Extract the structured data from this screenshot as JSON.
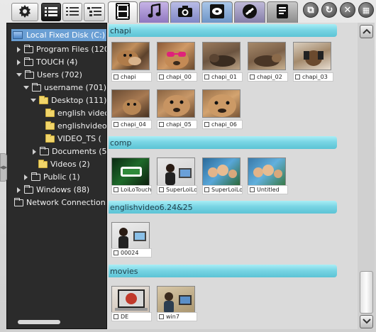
{
  "toolbar": {
    "settings_icon": "gear-icon",
    "view_buttons": [
      "details-view-icon",
      "list-view-icon",
      "tree-view-icon"
    ],
    "tabs": [
      {
        "name": "video",
        "icon": "film-icon",
        "active": true
      },
      {
        "name": "music",
        "icon": "music-note-icon",
        "active": false
      },
      {
        "name": "photo",
        "icon": "camera-icon",
        "active": false
      },
      {
        "name": "dvd",
        "icon": "dvd-icon",
        "active": false
      },
      {
        "name": "disc",
        "icon": "disc-icon",
        "active": false
      },
      {
        "name": "document",
        "icon": "document-icon",
        "active": false
      }
    ],
    "window_buttons": [
      "external-icon",
      "refresh-icon",
      "close-icon",
      "grid-menu-icon"
    ]
  },
  "sidebar": {
    "items": [
      {
        "label": "Local Fixed Disk (C:)",
        "selected": true
      },
      {
        "label": "Program Files  (120"
      },
      {
        "label": "TOUCH  (4)"
      },
      {
        "label": "Users  (702)"
      },
      {
        "label": "username  (701)"
      },
      {
        "label": "Desktop  (111)"
      },
      {
        "label": "english video"
      },
      {
        "label": "englishvideo"
      },
      {
        "label": "VIDEO_TS  ("
      },
      {
        "label": "Documents  (5"
      },
      {
        "label": "Videos  (2)"
      },
      {
        "label": "Public  (1)"
      },
      {
        "label": "Windows  (88)"
      },
      {
        "label": "Network Connection ("
      }
    ]
  },
  "groups": [
    {
      "name": "chapi",
      "items": [
        "chapi",
        "chapi_00",
        "chapi_01",
        "chapi_02",
        "chapi_03",
        "chapi_04",
        "chapi_05",
        "chapi_06"
      ]
    },
    {
      "name": "comp",
      "items": [
        "LoiLoTouch",
        "SuperLoiLoS",
        "SuperLoiLoS",
        "Untitled"
      ]
    },
    {
      "name": "englishvideo6.24&25",
      "items": [
        "00024"
      ]
    },
    {
      "name": "movies",
      "items": [
        "DE",
        "win7"
      ]
    }
  ],
  "colors": {
    "group_header": "#79d5e4",
    "sidebar_bg": "#2b2b2b",
    "selection": "#6a9fd4"
  }
}
